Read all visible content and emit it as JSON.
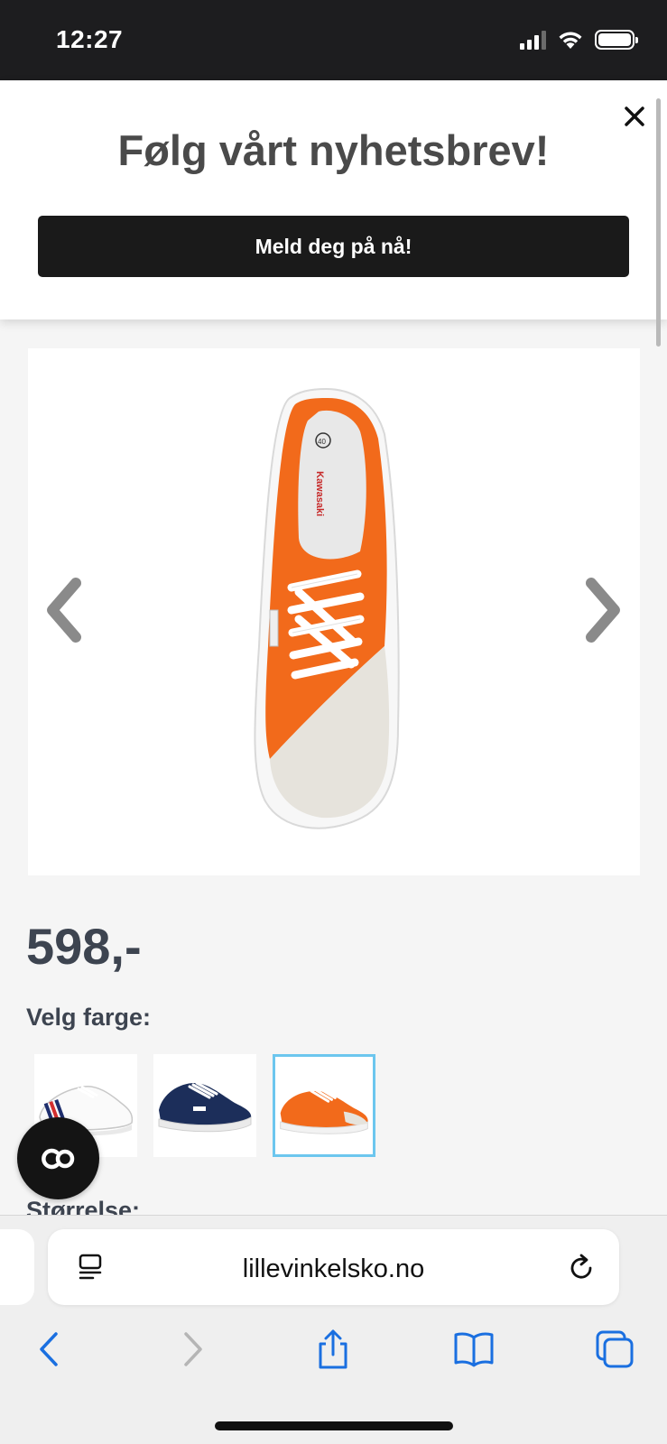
{
  "status_bar": {
    "time": "12:27"
  },
  "newsletter": {
    "title": "Følg vårt nyhetsbrev!",
    "button_label": "Meld deg på nå!"
  },
  "product": {
    "price": "598,-",
    "color_label": "Velg farge:",
    "size_label": "Størrelse:",
    "colors": [
      {
        "name": "white",
        "selected": false
      },
      {
        "name": "navy",
        "selected": false
      },
      {
        "name": "orange",
        "selected": true
      }
    ]
  },
  "browser": {
    "url": "lillevinkelsko.no"
  },
  "colors": {
    "accent_selected": "#6cc6ee",
    "safari_blue": "#1a6fe0",
    "shoe_orange": "#f26a1b"
  }
}
